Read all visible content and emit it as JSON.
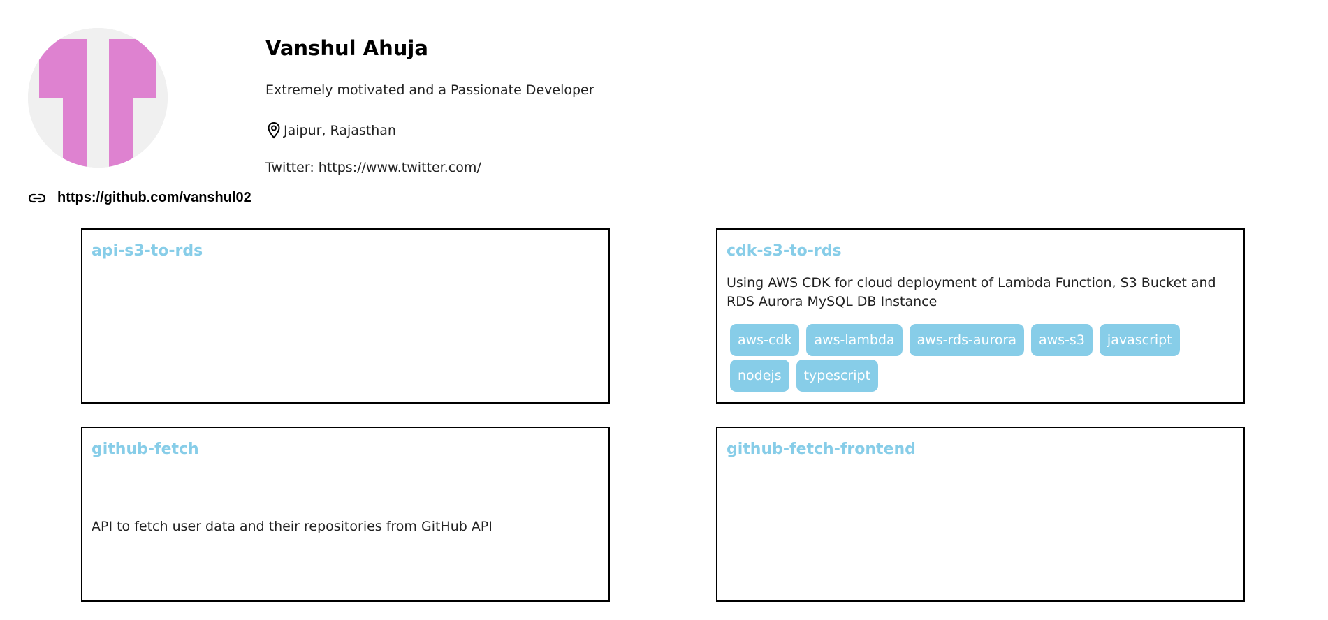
{
  "profile": {
    "name": "Vanshul Ahuja",
    "bio": "Extremely motivated and a Passionate Developer",
    "location": "Jaipur, Rajasthan",
    "twitter": "Twitter: https://www.twitter.com/",
    "github_url": "https://github.com/vanshul02",
    "avatar_color": "#de82d0",
    "avatar_bg": "#f0f0f0"
  },
  "icons": {
    "location": "map-pin-icon",
    "link": "link-icon"
  },
  "colors": {
    "accent": "#87cde8",
    "topic_text": "#ffffff"
  },
  "repos": [
    {
      "name": "api-s3-to-rds",
      "description": "",
      "topics": []
    },
    {
      "name": "cdk-s3-to-rds",
      "description": "Using AWS CDK for cloud deployment of Lambda Function, S3 Bucket and RDS Aurora MySQL DB Instance",
      "topics": [
        "aws-cdk",
        "aws-lambda",
        "aws-rds-aurora",
        "aws-s3",
        "javascript",
        "nodejs",
        "typescript"
      ]
    },
    {
      "name": "github-fetch",
      "description": "API to fetch user data and their repositories from GitHub API",
      "topics": []
    },
    {
      "name": "github-fetch-frontend",
      "description": "",
      "topics": []
    }
  ]
}
